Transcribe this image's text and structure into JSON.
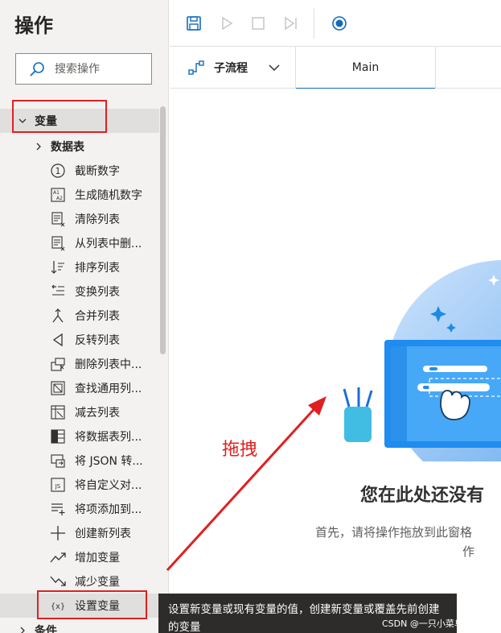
{
  "pane": {
    "title": "操作",
    "search_placeholder": "搜索操作"
  },
  "tree": {
    "group_variables": "变量",
    "group_datatable": "数据表",
    "items": [
      {
        "label": "截断数字",
        "icon": "circle-one-icon"
      },
      {
        "label": "生成随机数字",
        "icon": "random-number-icon"
      },
      {
        "label": "清除列表",
        "icon": "clear-list-icon"
      },
      {
        "label": "从列表中删...",
        "icon": "remove-from-list-icon"
      },
      {
        "label": "排序列表",
        "icon": "sort-list-icon"
      },
      {
        "label": "变换列表",
        "icon": "shuffle-list-icon"
      },
      {
        "label": "合并列表",
        "icon": "merge-list-icon"
      },
      {
        "label": "反转列表",
        "icon": "reverse-list-icon"
      },
      {
        "label": "删除列表中...",
        "icon": "remove-duplicates-icon"
      },
      {
        "label": "查找通用列...",
        "icon": "find-common-icon"
      },
      {
        "label": "减去列表",
        "icon": "subtract-list-icon"
      },
      {
        "label": "将数据表列...",
        "icon": "datatable-column-icon"
      },
      {
        "label": "将 JSON 转...",
        "icon": "json-convert-icon"
      },
      {
        "label": "将自定义对...",
        "icon": "custom-object-icon"
      },
      {
        "label": "将项添加到...",
        "icon": "add-item-icon"
      },
      {
        "label": "创建新列表",
        "icon": "plus-icon"
      },
      {
        "label": "增加变量",
        "icon": "trend-up-icon"
      },
      {
        "label": "减少变量",
        "icon": "trend-down-icon"
      },
      {
        "label": "设置变量",
        "icon": "variable-icon"
      }
    ],
    "group_conditions": "条件"
  },
  "toolbar": {
    "save": "save-icon",
    "run": "play-icon",
    "stop": "stop-icon",
    "step": "next-step-icon",
    "record": "record-icon"
  },
  "tabs": {
    "subflow_label": "子流程",
    "main_label": "Main"
  },
  "canvas": {
    "empty_title": "您在此处还没有",
    "empty_sub_line1": "首先，请将操作拖放到此窗格",
    "empty_sub_line2": "作"
  },
  "annotation": {
    "drag_label": "拖拽"
  },
  "tooltip": {
    "text": "设置新变量或现有变量的值，创建新变量或覆盖先前创建的变量"
  },
  "watermark": "CSDN @一只小菜鸟的博客",
  "colors": {
    "accent": "#0f6cbd",
    "annotation_red": "#e02020",
    "pane_bg": "#f3f2f1"
  }
}
